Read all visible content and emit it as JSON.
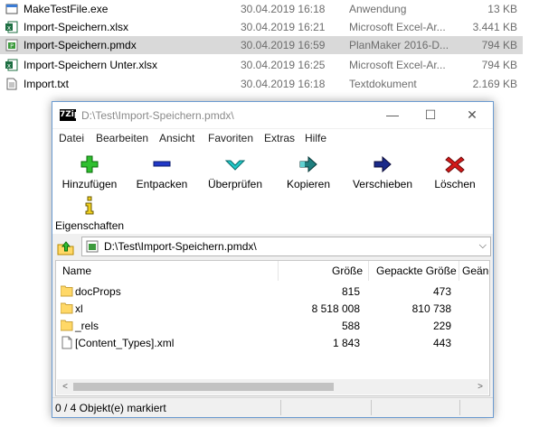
{
  "explorer": {
    "files": [
      {
        "icon": "exe-icon",
        "name": "MakeTestFile.exe",
        "date": "30.04.2019 16:18",
        "type": "Anwendung",
        "size": "13 KB",
        "selected": false
      },
      {
        "icon": "excel-file-icon",
        "name": "Import-Speichern.xlsx",
        "date": "30.04.2019 16:21",
        "type": "Microsoft Excel-Ar...",
        "size": "3.441 KB",
        "selected": false
      },
      {
        "icon": "planmaker-file-icon",
        "name": "Import-Speichern.pmdx",
        "date": "30.04.2019 16:59",
        "type": "PlanMaker 2016-D...",
        "size": "794 KB",
        "selected": true
      },
      {
        "icon": "excel-file-icon",
        "name": "Import-Speichern Unter.xlsx",
        "date": "30.04.2019 16:25",
        "type": "Microsoft Excel-Ar...",
        "size": "794 KB",
        "selected": false
      },
      {
        "icon": "text-file-icon",
        "name": "Import.txt",
        "date": "30.04.2019 16:18",
        "type": "Textdokument",
        "size": "2.169 KB",
        "selected": false
      }
    ]
  },
  "window": {
    "app_icon_text": "7Zip",
    "title": "D:\\Test\\Import-Speichern.pmdx\\",
    "minimize": "—",
    "maximize": "☐",
    "close": "✕"
  },
  "menu": [
    "Datei",
    "Bearbeiten",
    "Ansicht",
    "Favoriten",
    "Extras",
    "Hilfe"
  ],
  "toolbar": {
    "add": "Hinzufügen",
    "extract": "Entpacken",
    "test": "Überprüfen",
    "copy": "Kopieren",
    "move": "Verschieben",
    "delete": "Löschen",
    "info": "Eigenschaften"
  },
  "address": {
    "path": "D:\\Test\\Import-Speichern.pmdx\\",
    "dropdown": "⌵"
  },
  "list": {
    "columns": {
      "name": "Name",
      "size": "Größe",
      "packed": "Gepackte Größe",
      "modified": "Geänc"
    },
    "rows": [
      {
        "icon": "folder-icon",
        "name": "docProps",
        "size": "815",
        "packed": "473"
      },
      {
        "icon": "folder-icon",
        "name": "xl",
        "size": "8 518 008",
        "packed": "810 738"
      },
      {
        "icon": "folder-icon",
        "name": "_rels",
        "size": "588",
        "packed": "229"
      },
      {
        "icon": "file-icon",
        "name": "[Content_Types].xml",
        "size": "1 843",
        "packed": "443"
      }
    ]
  },
  "scroll": {
    "left": "<",
    "right": ">"
  },
  "status": {
    "text": "0 / 4 Objekt(e) markiert"
  },
  "colors": {
    "accent": "#0078d7",
    "selection": "#d9d9d9",
    "folder": "#ffd867",
    "window_bg": "#f0f0f0"
  }
}
